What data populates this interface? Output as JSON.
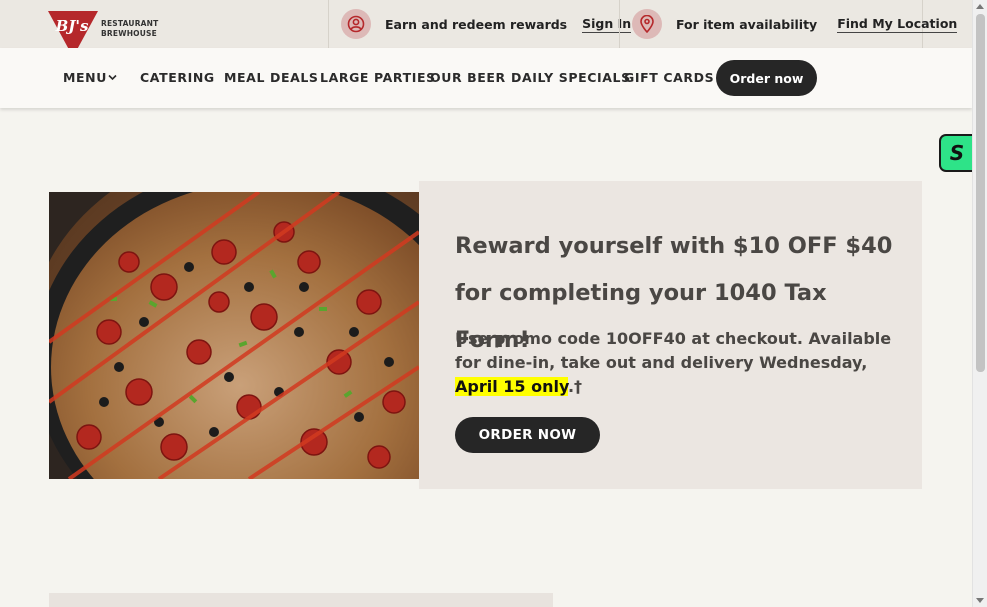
{
  "brand": {
    "logo_mark": "BJ's",
    "logo_line1": "RESTAURANT",
    "logo_line2": "BREWHOUSE",
    "accent_color": "#b5282b"
  },
  "utility": {
    "rewards": {
      "icon": "user-circle-icon",
      "text": "Earn and redeem rewards",
      "link": "Sign In"
    },
    "location": {
      "icon": "map-pin-icon",
      "text": "For item availability",
      "link": "Find My Location"
    }
  },
  "nav": {
    "menu": "MENU",
    "catering": "CATERING",
    "meal_deals": "MEAL DEALS",
    "large_parties": "LARGE PARTIES",
    "our_beer": "OUR BEER",
    "daily_specials": "DAILY SPECIALS",
    "gift_cards": "GIFT CARDS",
    "order_now": "Order now"
  },
  "side_widget": {
    "label": "S",
    "color": "#2ee388"
  },
  "promo": {
    "image_alt": "deep dish pizza",
    "title": "Reward yourself with $10 OFF $40 for completing your 1040 Tax Form!",
    "body_prefix": "Use promo code 10OFF40 at checkout. Available for dine-in, take out and delivery Wednesday, ",
    "body_highlight": "April 15 only",
    "body_suffix": ".†",
    "cta": "ORDER NOW"
  }
}
